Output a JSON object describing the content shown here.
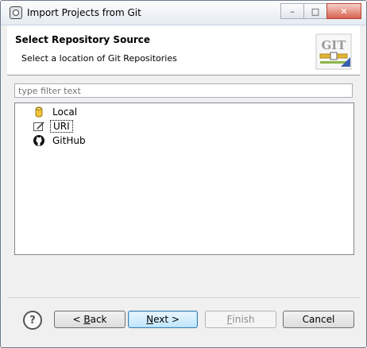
{
  "window": {
    "title": "Import Projects from Git",
    "controls": {
      "minimize": "–",
      "maximize": "□",
      "close": "✕"
    }
  },
  "header": {
    "title": "Select Repository Source",
    "description": "Select a location of Git Repositories",
    "logo_text": "GIT"
  },
  "filter": {
    "placeholder": "type filter text",
    "value": ""
  },
  "sources": [
    {
      "label": "Local",
      "icon": "repository-cylinder-icon"
    },
    {
      "label": "URI",
      "icon": "uri-edit-icon",
      "selected": true
    },
    {
      "label": "GitHub",
      "icon": "github-octocat-icon"
    }
  ],
  "buttons": {
    "help": "?",
    "back_prefix": "< ",
    "back_mnemonic": "B",
    "back_rest": "ack",
    "next_mnemonic": "N",
    "next_rest": "ext >",
    "finish_mnemonic": "F",
    "finish_rest": "inish",
    "cancel": "Cancel"
  },
  "colors": {
    "accent": "#3c7fb1",
    "header_bg": "#ffffff",
    "dialog_bg": "#f0f0f0"
  }
}
